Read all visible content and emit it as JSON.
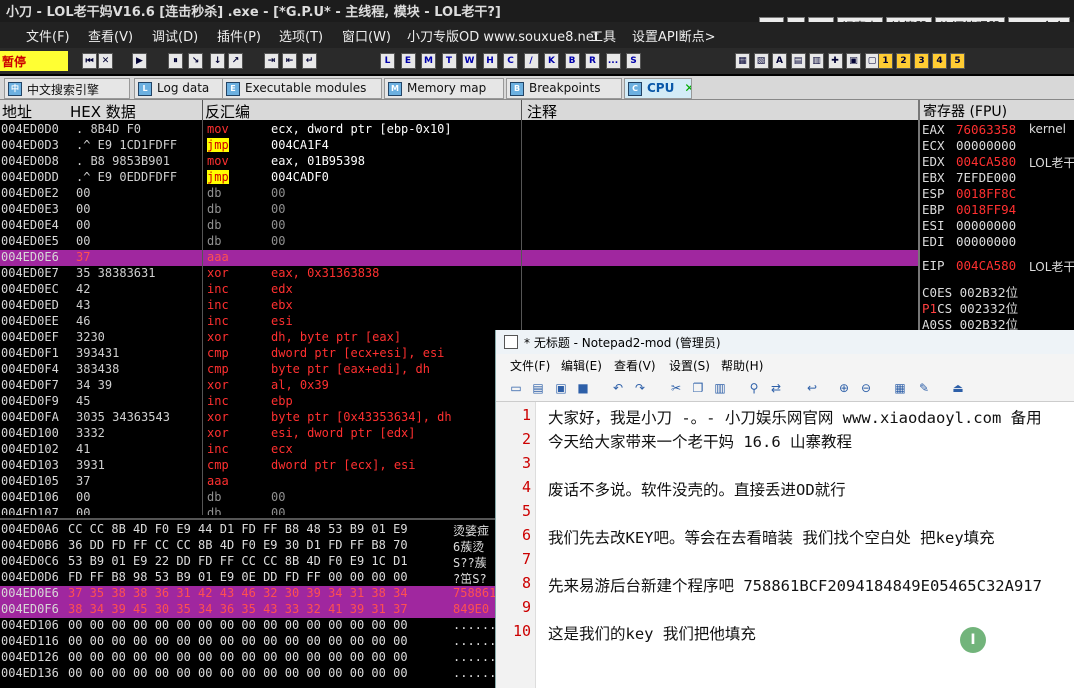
{
  "window": {
    "title": "小刀   - LOL老干妈V16.6 [连击秒杀] .exe - [*G.P.U* - 主线程, 模块 - LOL老干?]"
  },
  "title_buttons": [
    "BP",
    "P",
    "VB",
    "记事本",
    "计算器",
    "资源管理器",
    "CMD命令"
  ],
  "menu": [
    "文件(F)",
    "查看(V)",
    "调试(D)",
    "插件(P)",
    "选项(T)",
    "窗口(W)",
    "小刀专版OD www.souxue8.net",
    "工具",
    "设置API断点>"
  ],
  "toolbar": {
    "pause_label": "暂停",
    "letters": [
      "L",
      "E",
      "M",
      "T",
      "W",
      "H",
      "C",
      "/",
      "K",
      "B",
      "R",
      "...",
      "S"
    ],
    "numbers": [
      "1",
      "2",
      "3",
      "4",
      "5"
    ]
  },
  "tabs": [
    {
      "icon": "中",
      "label": "中文搜索引擎"
    },
    {
      "icon": "L",
      "label": "Log data"
    },
    {
      "icon": "E",
      "label": "Executable modules"
    },
    {
      "icon": "M",
      "label": "Memory map"
    },
    {
      "icon": "B",
      "label": "Breakpoints"
    },
    {
      "icon": "C",
      "label": "CPU"
    }
  ],
  "columns": {
    "addr": "地址",
    "hex": "HEX 数据",
    "disasm": "反汇编",
    "comment": "注释"
  },
  "disasm_rows": [
    {
      "addr": "004ED0D0",
      "hex": " .  8B4D F0",
      "mnem": "mov",
      "ops": "ecx, dword ptr [ebp-0x10]",
      "hl": false
    },
    {
      "addr": "004ED0D3",
      "hex": " .^ E9 1CD1FDFF",
      "mnem": "jmp",
      "ops": "004CA1F4",
      "hl": true
    },
    {
      "addr": "004ED0D8",
      "hex": " .  B8 9853B901",
      "mnem": "mov",
      "ops": "eax, 01B95398",
      "hl": false
    },
    {
      "addr": "004ED0DD",
      "hex": " .^ E9 0EDDFDFF",
      "mnem": "jmp",
      "ops": "004CADF0",
      "hl": true
    },
    {
      "addr": "004ED0E2",
      "hex": "    00",
      "mnem": "db",
      "ops": "00",
      "hl": false
    },
    {
      "addr": "004ED0E3",
      "hex": "    00",
      "mnem": "db",
      "ops": "00",
      "hl": false
    },
    {
      "addr": "004ED0E4",
      "hex": "    00",
      "mnem": "db",
      "ops": "00",
      "hl": false
    },
    {
      "addr": "004ED0E5",
      "hex": "    00",
      "mnem": "db",
      "ops": "00",
      "hl": false
    },
    {
      "addr": "004ED0E6",
      "hex": "    37",
      "mnem": "aaa",
      "ops": "",
      "hl": false,
      "sel": true
    },
    {
      "addr": "004ED0E7",
      "hex": "    35 38383631",
      "mnem": "xor",
      "ops": "eax, 0x31363838",
      "hl": false
    },
    {
      "addr": "004ED0EC",
      "hex": "    42",
      "mnem": "inc",
      "ops": "edx",
      "hl": false
    },
    {
      "addr": "004ED0ED",
      "hex": "    43",
      "mnem": "inc",
      "ops": "ebx",
      "hl": false
    },
    {
      "addr": "004ED0EE",
      "hex": "    46",
      "mnem": "inc",
      "ops": "esi",
      "hl": false
    },
    {
      "addr": "004ED0EF",
      "hex": "    3230",
      "mnem": "xor",
      "ops": "dh, byte ptr [eax]",
      "hl": false
    },
    {
      "addr": "004ED0F1",
      "hex": "    393431",
      "mnem": "cmp",
      "ops": "dword ptr [ecx+esi], esi",
      "hl": false
    },
    {
      "addr": "004ED0F4",
      "hex": "    383438",
      "mnem": "cmp",
      "ops": "byte ptr [eax+edi], dh",
      "hl": false
    },
    {
      "addr": "004ED0F7",
      "hex": "    34 39",
      "mnem": "xor",
      "ops": "al, 0x39",
      "hl": false
    },
    {
      "addr": "004ED0F9",
      "hex": "    45",
      "mnem": "inc",
      "ops": "ebp",
      "hl": false
    },
    {
      "addr": "004ED0FA",
      "hex": "    3035 34363543",
      "mnem": "xor",
      "ops": "byte ptr [0x43353634], dh",
      "hl": false
    },
    {
      "addr": "004ED100",
      "hex": "    3332",
      "mnem": "xor",
      "ops": "esi, dword ptr [edx]",
      "hl": false
    },
    {
      "addr": "004ED102",
      "hex": "    41",
      "mnem": "inc",
      "ops": "ecx",
      "hl": false
    },
    {
      "addr": "004ED103",
      "hex": "    3931",
      "mnem": "cmp",
      "ops": "dword ptr [ecx], esi",
      "hl": false
    },
    {
      "addr": "004ED105",
      "hex": "    37",
      "mnem": "aaa",
      "ops": "",
      "hl": false
    },
    {
      "addr": "004ED106",
      "hex": "    00",
      "mnem": "db",
      "ops": "00",
      "hl": false
    },
    {
      "addr": "004ED107",
      "hex": "    00",
      "mnem": "db",
      "ops": "00",
      "hl": false
    }
  ],
  "hex_rows": [
    {
      "addr": "004ED0A6",
      "bytes": "CC CC 8B 4D F0 E9 44 D1 FD FF B8 48 53 B9 01 E9",
      "ascii": "烫婱痖"
    },
    {
      "addr": "004ED0B6",
      "bytes": "36 DD FD FF CC CC 8B 4D F0 E9 30 D1 FD FF B8 70",
      "ascii": "6蔟烫"
    },
    {
      "addr": "004ED0C6",
      "bytes": "53 B9 01 E9 22 DD FD FF CC CC 8B 4D F0 E9 1C D1",
      "ascii": "S??蔟"
    },
    {
      "addr": "004ED0D6",
      "bytes": "FD FF B8 98 53 B9 01 E9 0E DD FD FF 00 00 00 00",
      "ascii": "?笜S?"
    },
    {
      "addr": "004ED0E6",
      "bytes": "37 35 38 38 36 31 42 43 46 32 30 39 34 31 38 34",
      "ascii": "758861",
      "sel": true
    },
    {
      "addr": "004ED0F6",
      "bytes": "38 34 39 45 30 35 34 36 35 43 33 32 41 39 31 37",
      "ascii": "849E0",
      "sel": true
    },
    {
      "addr": "004ED106",
      "bytes": "00 00 00 00 00 00 00 00 00 00 00 00 00 00 00 00",
      "ascii": "......"
    },
    {
      "addr": "004ED116",
      "bytes": "00 00 00 00 00 00 00 00 00 00 00 00 00 00 00 00",
      "ascii": "......"
    },
    {
      "addr": "004ED126",
      "bytes": "00 00 00 00 00 00 00 00 00 00 00 00 00 00 00 00",
      "ascii": "......"
    },
    {
      "addr": "004ED136",
      "bytes": "00 00 00 00 00 00 00 00 00 00 00 00 00 00 00 00",
      "ascii": "......"
    }
  ],
  "registers": {
    "header": "寄存器 (FPU)",
    "list": [
      {
        "name": "EAX",
        "value": "76063358",
        "red": true,
        "comment": "kernel"
      },
      {
        "name": "ECX",
        "value": "00000000",
        "red": false,
        "comment": ""
      },
      {
        "name": "EDX",
        "value": "004CA580",
        "red": true,
        "comment": "LOL老干"
      },
      {
        "name": "EBX",
        "value": "7EFDE000",
        "red": false,
        "comment": ""
      },
      {
        "name": "ESP",
        "value": "0018FF8C",
        "red": true,
        "comment": ""
      },
      {
        "name": "EBP",
        "value": "0018FF94",
        "red": true,
        "comment": ""
      },
      {
        "name": "ESI",
        "value": "00000000",
        "red": false,
        "comment": ""
      },
      {
        "name": "EDI",
        "value": "00000000",
        "red": false,
        "comment": ""
      },
      {
        "name": "EIP",
        "value": "004CA580",
        "red": true,
        "comment": "LOL老干"
      }
    ],
    "flags": [
      {
        "flag": "C",
        "bit": "0",
        "seg": "ES 002B",
        "bits": "32位"
      },
      {
        "flag": "P",
        "bit": "1",
        "seg": "CS 0023",
        "bits": "32位"
      },
      {
        "flag": "A",
        "bit": "0",
        "seg": "SS 002B",
        "bits": "32位"
      }
    ]
  },
  "notepad": {
    "title": "* 无标题 - Notepad2-mod (管理员)",
    "menu": [
      "文件(F)",
      "编辑(E)",
      "查看(V)",
      "设置(S)",
      "帮助(H)"
    ],
    "lines": [
      "大家好，我是小刀  -。- 小刀娱乐网官网 www.xiaodaoyl.com 备用",
      "今天给大家带来一个老干妈 16.6 山寨教程",
      "",
      "废话不多说。软件没壳的。直接丢进OD就行",
      "",
      "我们先去改KEY吧。等会在去看暗装 我们找个空白处 把key填充",
      "",
      "先来易游后台新建个程序吧  758861BCF2094184849E05465C32A917",
      "",
      "这是我们的key 我们把他填充"
    ],
    "cursor_glyph": "I"
  }
}
